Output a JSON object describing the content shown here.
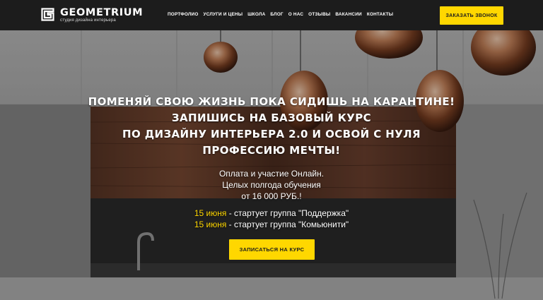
{
  "header": {
    "logo_name": "GEOMETRIUM",
    "logo_tagline": "студия дизайна интерьера",
    "logo_icon": "geometrium-logo-mark",
    "nav": [
      {
        "label": "ПОРТФОЛИО"
      },
      {
        "label": "УСЛУГИ И ЦЕНЫ"
      },
      {
        "label": "ШКОЛА"
      },
      {
        "label": "БЛОГ"
      },
      {
        "label": "О НАС"
      },
      {
        "label": "ОТЗЫВЫ"
      },
      {
        "label": "ВАКАНСИИ"
      },
      {
        "label": "КОНТАКТЫ"
      }
    ],
    "call_button": "ЗАКАЗАТЬ ЗВОНОК"
  },
  "hero": {
    "headline": [
      "ПОМЕНЯЙ СВОЮ ЖИЗНЬ ПОКА СИДИШЬ НА КАРАНТИНЕ!",
      "ЗАПИШИСЬ НА БАЗОВЫЙ КУРС",
      "ПО ДИЗАЙНУ ИНТЕРЬЕРА 2.0 И ОСВОЙ С НУЛЯ",
      "ПРОФЕССИЮ МЕЧТЫ!"
    ],
    "info": [
      "Оплата и участие Онлайн.",
      "Целых полгода обучения",
      "от 16 000 РУБ.!"
    ],
    "starts": [
      {
        "date": "15 июня",
        "text": " - стартует группа \"Поддержка\""
      },
      {
        "date": "15 июня",
        "text": " - стартует группа \"Комьюнити\""
      }
    ],
    "enroll_button": "ЗАПИСАТЬСЯ НА КУРС"
  },
  "colors": {
    "accent": "#ffd700",
    "header_bg": "#1c1c1c",
    "text": "#ffffff"
  }
}
